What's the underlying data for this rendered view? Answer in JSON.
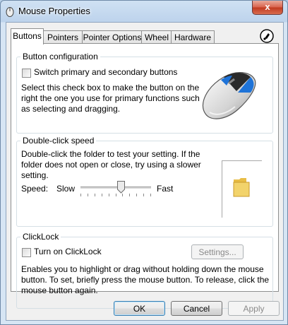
{
  "window": {
    "title": "Mouse Properties",
    "close_label": "x"
  },
  "tabs": [
    {
      "label": "Buttons",
      "active": true
    },
    {
      "label": "Pointers"
    },
    {
      "label": "Pointer Options"
    },
    {
      "label": "Wheel"
    },
    {
      "label": "Hardware"
    }
  ],
  "button_config": {
    "legend": "Button configuration",
    "checkbox_label": "Switch primary and secondary buttons",
    "checked": false,
    "desc_lines": [
      "Select this check box to make the button on the",
      "right the one you use for primary functions such",
      "as selecting and dragging."
    ]
  },
  "double_click": {
    "legend": "Double-click speed",
    "desc_lines": [
      "Double-click the folder to test your setting. If the",
      "folder does not open or close, try using a slower",
      "setting."
    ],
    "speed_label": "Speed:",
    "slow_label": "Slow",
    "fast_label": "Fast",
    "speed_value": 0.57,
    "tick_count": 11
  },
  "clicklock": {
    "legend": "ClickLock",
    "checkbox_label": "Turn on ClickLock",
    "checked": false,
    "settings_label": "Settings...",
    "desc_lines": [
      "Enables you to highlight or drag without holding down the mouse",
      "button. To set, briefly press the mouse button. To release, click the",
      "mouse button again."
    ]
  },
  "footer": {
    "ok_label": "OK",
    "cancel_label": "Cancel",
    "apply_label": "Apply"
  },
  "colors": {
    "mouse_accent": "#1e73d8",
    "folder": "#f2d36b"
  }
}
